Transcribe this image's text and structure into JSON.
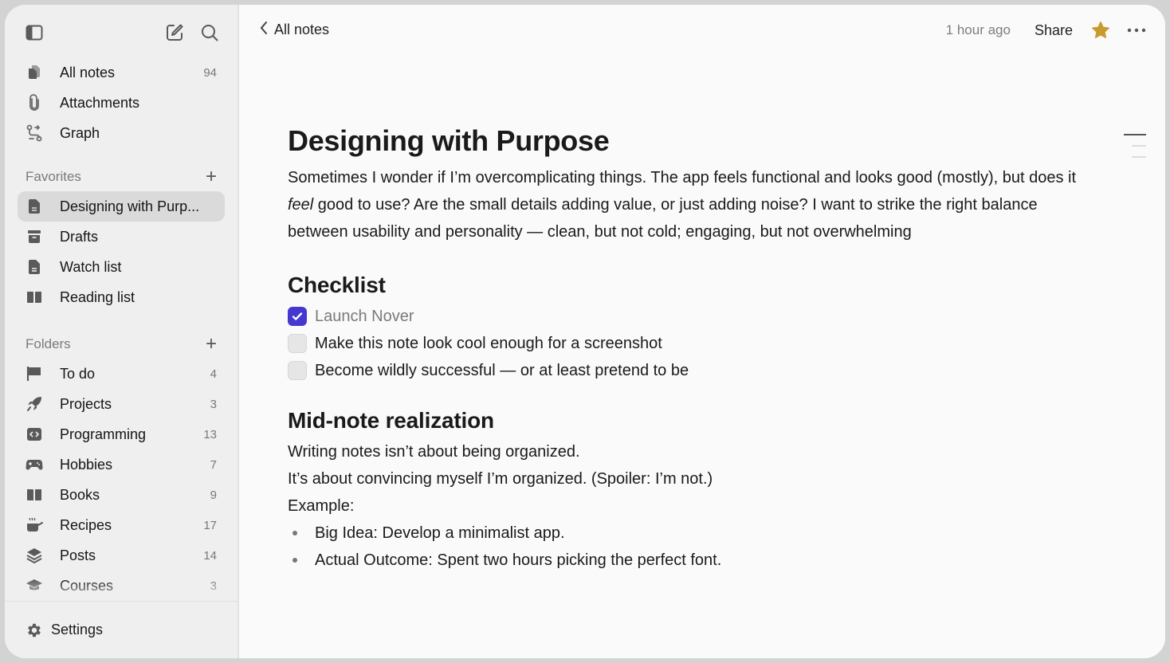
{
  "sidebar": {
    "top_items": [
      {
        "label": "All notes",
        "count": "94",
        "icon": "notes-icon"
      },
      {
        "label": "Attachments",
        "count": "",
        "icon": "paperclip-icon"
      },
      {
        "label": "Graph",
        "count": "",
        "icon": "graph-icon"
      }
    ],
    "favorites": {
      "title": "Favorites",
      "items": [
        {
          "label": "Designing with Purp...",
          "icon": "document-icon",
          "active": true
        },
        {
          "label": "Drafts",
          "icon": "archive-icon"
        },
        {
          "label": "Watch list",
          "icon": "document-icon"
        },
        {
          "label": "Reading list",
          "icon": "book-icon"
        }
      ]
    },
    "folders": {
      "title": "Folders",
      "items": [
        {
          "label": "To do",
          "count": "4",
          "icon": "flag-icon"
        },
        {
          "label": "Projects",
          "count": "3",
          "icon": "rocket-icon"
        },
        {
          "label": "Programming",
          "count": "13",
          "icon": "code-icon"
        },
        {
          "label": "Hobbies",
          "count": "7",
          "icon": "gamepad-icon"
        },
        {
          "label": "Books",
          "count": "9",
          "icon": "book-icon"
        },
        {
          "label": "Recipes",
          "count": "17",
          "icon": "cooking-pot-icon"
        },
        {
          "label": "Posts",
          "count": "14",
          "icon": "layers-icon"
        },
        {
          "label": "Courses",
          "count": "3",
          "icon": "graduation-cap-icon"
        }
      ]
    },
    "settings_label": "Settings"
  },
  "topbar": {
    "back_label": "All notes",
    "timestamp": "1 hour ago",
    "share_label": "Share",
    "star_color": "#c99a2e"
  },
  "note": {
    "title": "Designing with Purpose",
    "intro": {
      "before": "Sometimes I wonder if I’m overcomplicating things. The app feels functional and looks good (mostly), but does it ",
      "emphasis": "feel",
      "after": " good to use? Are the small details adding value, or just adding noise? I want to strike the right balance between usability and personality — clean, but not cold; engaging, but not overwhelming"
    },
    "checklist_heading": "Checklist",
    "checklist": [
      {
        "text": "Launch Nover",
        "checked": true
      },
      {
        "text": "Make this note look cool enough for a screenshot",
        "checked": false
      },
      {
        "text": "Become wildly successful — or at least pretend to be",
        "checked": false
      }
    ],
    "realization_heading": "Mid-note realization",
    "lines": [
      "Writing notes isn’t about being organized.",
      "It’s about convincing myself I’m organized. (Spoiler: I’m not.)",
      "Example:"
    ],
    "bullets": [
      "Big Idea: Develop a minimalist app.",
      "Actual Outcome: Spent two hours picking the perfect font."
    ]
  },
  "colors": {
    "accent": "#4537cf",
    "star": "#c99a2e",
    "sidebar_bg": "#efefef",
    "active_item_bg": "#dadada"
  }
}
